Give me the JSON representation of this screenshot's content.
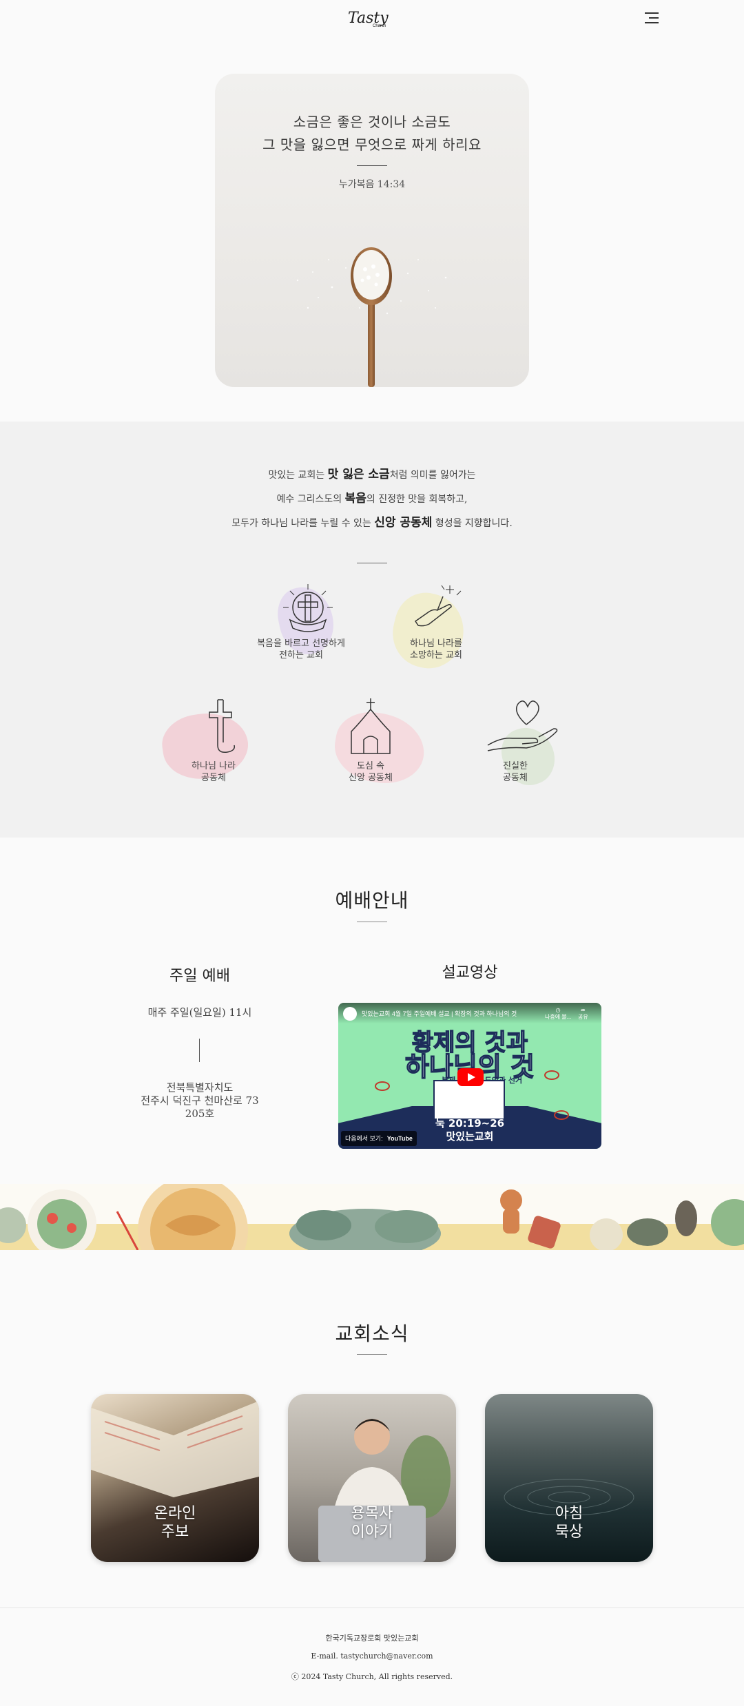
{
  "header": {
    "logo_text": "Tasty",
    "logo_sub": "Church"
  },
  "hero": {
    "line1": "소금은 좋은 것이나 소금도",
    "line2": "그 맛을 잃으면 무엇으로 짜게 하리요",
    "reference": "누가복음 14:34"
  },
  "mission": {
    "line1": [
      "맛있는 교회는 ",
      "맛 잃은 소금",
      "처럼 의미를 잃어가는"
    ],
    "line2": [
      "예수 그리스도의 ",
      "복음",
      "의 진정한 맛을 회복하고,"
    ],
    "line3": [
      "모두가 하나님 나라를 누릴 수 있는 ",
      "신앙 공동체",
      " 형성을 지향합니다."
    ],
    "values": [
      {
        "label1": "복음을 바르고 선명하게",
        "label2": "전하는 교회",
        "icon": "cross-sun-icon",
        "color": "#d9c8ec"
      },
      {
        "label1": "하나님 나라를",
        "label2": "소망하는 교회",
        "icon": "hand-sparkle-icon",
        "color": "#f0ebb0"
      },
      {
        "label1": "하나님 나라",
        "label2": "공동체",
        "icon": "grave-cross-icon",
        "color": "#f3b8c3"
      },
      {
        "label1": "도심 속",
        "label2": "신앙 공동체",
        "icon": "chapel-icon",
        "color": "#f7c9cf"
      },
      {
        "label1": "진실한",
        "label2": "공동체",
        "icon": "heart-hand-icon",
        "color": "#cfe0c4"
      }
    ]
  },
  "worship": {
    "title": "예배안내",
    "sunday_title": "주일 예배",
    "sunday_time": "매주 주일(일요일) 11시",
    "address1": "전북특별자치도",
    "address2": "전주시 덕진구 천마산로 73",
    "address3": "205호",
    "sermon_title": "설교영상",
    "video": {
      "title": "맛있는교회 4월 7일 주일예배 설교 | 확장의 것과 하나님의 것",
      "big1": "황제의 것과",
      "big2": "하나님의 것",
      "sub": "부제 : 그리스도인과 선거",
      "verse": "눅 20:19~26",
      "church": "맛있는교회",
      "watch_on": "다음에서 보기:",
      "youtube": "YouTube",
      "later": "나중에 볼...",
      "share": "공유"
    }
  },
  "news": {
    "title": "교회소식",
    "cards": [
      {
        "line1": "온라인",
        "line2": "주보"
      },
      {
        "line1": "용목사",
        "line2": "이야기"
      },
      {
        "line1": "아침",
        "line2": "묵상"
      }
    ]
  },
  "footer": {
    "name": "한국기독교장로회 맛있는교회",
    "email": "E-mail. tastychurch@naver.com",
    "copyright": "ⓒ 2024 Tasty Church, All rights reserved."
  },
  "colors": {
    "background": "#fafafa",
    "mission_bg": "#f1f1f1",
    "video_green": "#93e8b0",
    "video_navy": "#1d2d5a"
  }
}
